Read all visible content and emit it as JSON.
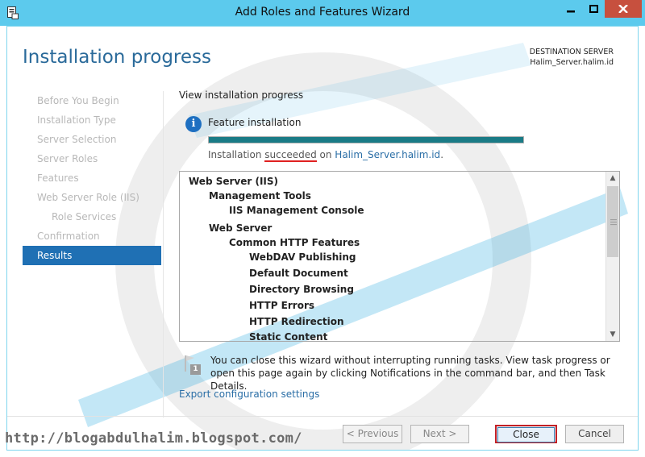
{
  "window": {
    "title": "Add Roles and Features Wizard",
    "title_bar_color": "#5ccaed",
    "close_button_color": "#c7503e"
  },
  "page": {
    "title": "Installation progress",
    "destination_label": "DESTINATION SERVER",
    "destination_server": "Halim_Server.halim.id"
  },
  "nav": {
    "items": [
      {
        "label": "Before You Begin",
        "state": "disabled"
      },
      {
        "label": "Installation Type",
        "state": "disabled"
      },
      {
        "label": "Server Selection",
        "state": "disabled"
      },
      {
        "label": "Server Roles",
        "state": "disabled"
      },
      {
        "label": "Features",
        "state": "disabled"
      },
      {
        "label": "Web Server Role (IIS)",
        "state": "disabled"
      },
      {
        "label": "Role Services",
        "state": "disabled"
      },
      {
        "label": "Confirmation",
        "state": "disabled"
      },
      {
        "label": "Results",
        "state": "active"
      }
    ],
    "active_color": "#1f70b4"
  },
  "main": {
    "heading": "View installation progress",
    "feature_label": "Feature installation",
    "progress_fraction": 1.0,
    "status_prefix": "Installation ",
    "status_word": "succeeded",
    "status_middle": " on ",
    "status_server": "Halim_Server.halim.id",
    "status_suffix": ".",
    "results": [
      "Web Server (IIS)",
      "Management Tools",
      "IIS Management Console",
      "Web Server",
      "Common HTTP Features",
      "WebDAV Publishing",
      "Default Document",
      "Directory Browsing",
      "HTTP Errors",
      "HTTP Redirection",
      "Static Content"
    ],
    "flag_badge": "1",
    "note": "You can close this wizard without interrupting running tasks. View task progress or open this page again by clicking Notifications in the command bar, and then Task Details.",
    "export_link": "Export configuration settings"
  },
  "buttons": {
    "previous": "< Previous",
    "next": "Next >",
    "close": "Close",
    "cancel": "Cancel"
  },
  "watermark": {
    "url": "http://blogabdulhalim.blogspot.com/"
  }
}
